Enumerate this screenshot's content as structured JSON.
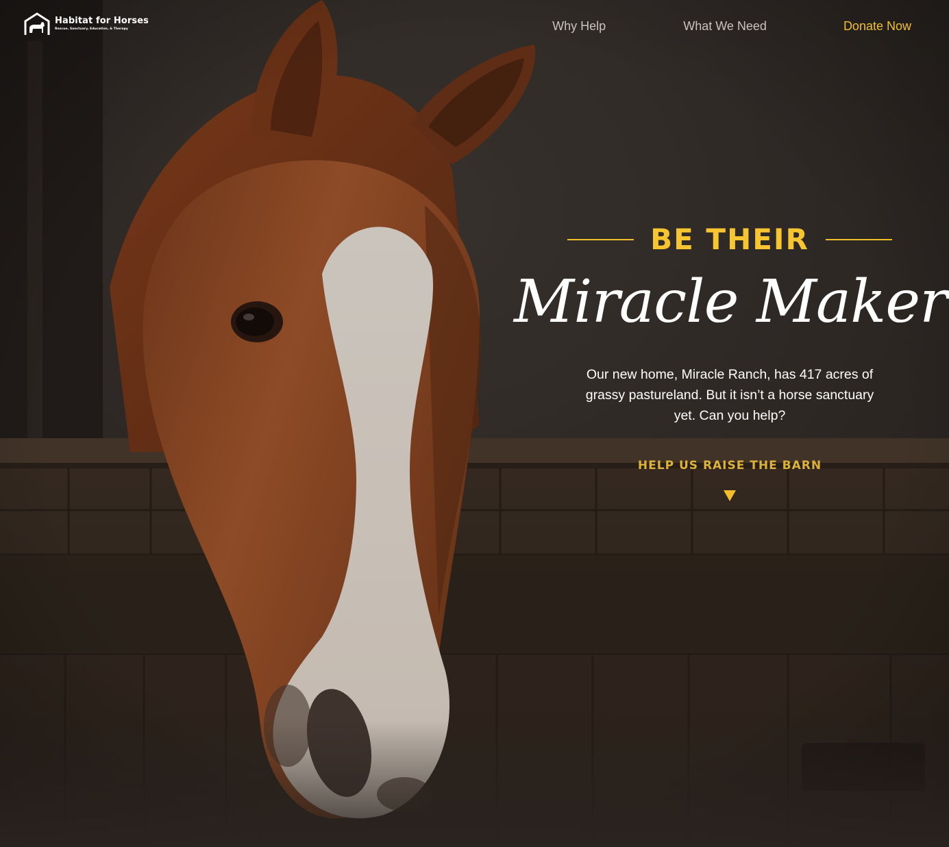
{
  "header": {
    "logo": {
      "name": "Habitat for Horses",
      "tagline": "Rescue, Sanctuary, Education, & Therapy",
      "icon": "horse-barn-icon"
    },
    "nav": [
      {
        "label": "Why Help"
      },
      {
        "label": "What We Need"
      },
      {
        "label": "Donate Now",
        "accent": "#f2bf2b"
      }
    ]
  },
  "hero": {
    "pretitle": "BE THEIR",
    "title": "Miracle Maker",
    "body": "Our new home, Miracle Ranch, has 417 acres of grassy pastureland. But it isn’t a horse sanctuary yet. Can you help?",
    "cta_label": "HELP US RAISE THE BARN",
    "cta_icon": "triangle-down-icon",
    "background": "chestnut-horse-in-stall-photo"
  },
  "colors": {
    "accent": "#f2bf2b",
    "nav_text": "#c9c3bc",
    "background": "#2c2520"
  }
}
